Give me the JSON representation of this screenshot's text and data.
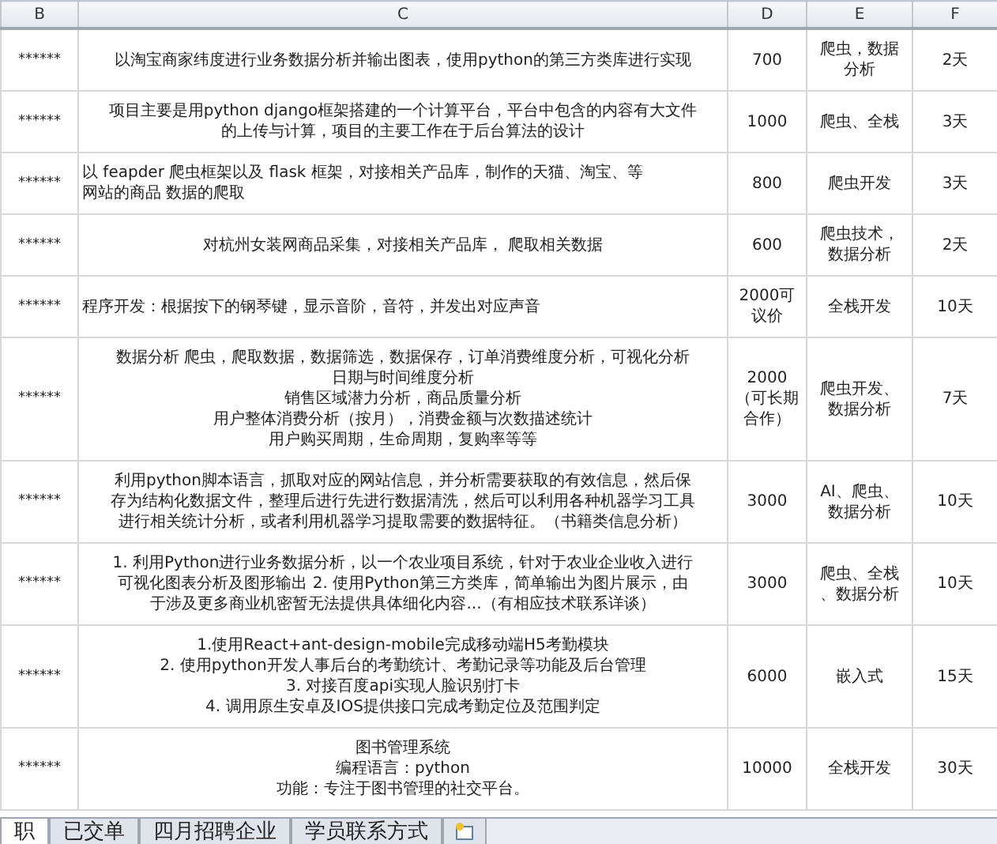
{
  "columns": [
    "B",
    "C",
    "D",
    "E",
    "F"
  ],
  "rows": [
    {
      "cells": [
        "******",
        "以淘宝商家纬度进行业务数据分析并输出图表，使用python的第三方类库进行实现",
        "700",
        [
          "爬虫，数据",
          "分析"
        ],
        "2天"
      ],
      "left_aligned": false
    },
    {
      "cells": [
        "******",
        [
          "项目主要是用python django框架搭建的一个计算平台，平台中包含的内容有大文件",
          "的上传与计算，项目的主要工作在于后台算法的设计"
        ],
        "1000",
        "爬虫、全栈",
        "3天"
      ],
      "left_aligned": false
    },
    {
      "cells": [
        "******",
        [
          "以 feapder 爬虫框架以及 flask 框架，对接相关产品库，制作的天猫、淘宝、等",
          "网站的商品 数据的爬取"
        ],
        "800",
        "爬虫开发",
        "3天"
      ],
      "left_aligned": true
    },
    {
      "cells": [
        "******",
        "对杭州女装网商品采集，对接相关产品库， 爬取相关数据",
        "600",
        [
          "爬虫技术，",
          "数据分析"
        ],
        "2天"
      ],
      "left_aligned": false
    },
    {
      "cells": [
        "******",
        "程序开发：根据按下的钢琴键，显示音阶，音符，并发出对应声音",
        [
          "2000可",
          "议价"
        ],
        "全栈开发",
        "10天"
      ],
      "left_aligned": true
    },
    {
      "cells": [
        "******",
        [
          "数据分析 爬虫，爬取数据，数据筛选，数据保存，订单消费维度分析，可视化分析",
          "日期与时间维度分析",
          "销售区域潜力分析，商品质量分析",
          "用户整体消费分析（按月），消费金额与次数描述统计",
          "用户购买周期，生命周期，复购率等等"
        ],
        [
          "2000",
          "（可长期",
          "合作）"
        ],
        [
          "爬虫开发、",
          "数据分析"
        ],
        "7天"
      ],
      "left_aligned": false
    },
    {
      "cells": [
        "******",
        [
          "利用python脚本语言，抓取对应的网站信息，并分析需要获取的有效信息，然后保",
          "存为结构化数据文件，整理后进行先进行数据清洗，然后可以利用各种机器学习工具",
          "进行相关统计分析，或者利用机器学习提取需要的数据特征。（书籍类信息分析）"
        ],
        "3000",
        [
          "AI、爬虫、",
          "数据分析"
        ],
        "10天"
      ],
      "left_aligned": false
    },
    {
      "cells": [
        "******",
        [
          "1. 利用Python进行业务数据分析，以一个农业项目系统，针对于农业企业收入进行",
          "可视化图表分析及图形输出 2. 使用Python第三方类库，简单输出为图片展示，由",
          "于涉及更多商业机密暂无法提供具体细化内容...（有相应技术联系详谈）"
        ],
        "3000",
        [
          "爬虫、全栈",
          "、数据分析"
        ],
        "10天"
      ],
      "left_aligned": false
    },
    {
      "cells": [
        "******",
        [
          "1.使用React+ant-design-mobile完成移动端H5考勤模块",
          "2. 使用python开发人事后台的考勤统计、考勤记录等功能及后台管理",
          "3. 对接百度api实现人脸识别打卡",
          "4. 调用原生安卓及IOS提供接口完成考勤定位及范围判定"
        ],
        "6000",
        "嵌入式",
        "15天"
      ],
      "left_aligned": false
    },
    {
      "cells": [
        "******",
        [
          "图书管理系统",
          "编程语言：python",
          "功能：专注于图书管理的社交平台。"
        ],
        "10000",
        "全栈开发",
        "30天"
      ],
      "left_aligned": false
    }
  ],
  "sheet_tabs": [
    {
      "label": "职",
      "selected": true
    },
    {
      "label": "已交单",
      "selected": false
    },
    {
      "label": "四月招聘企业",
      "selected": false
    },
    {
      "label": "学员联系方式",
      "selected": false
    }
  ]
}
